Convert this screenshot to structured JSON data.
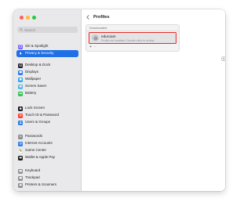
{
  "window": {
    "title": "Profiles"
  },
  "search": {
    "placeholder": "Search"
  },
  "sidebar": {
    "items": [
      {
        "label": "Siri & Spotlight",
        "icon": "siri-icon",
        "color": "#7b61ff",
        "active": false
      },
      {
        "label": "Privacy & Security",
        "icon": "hand-icon",
        "color": "#1f6fe6",
        "active": true
      },
      {
        "label": "Desktop & Dock",
        "icon": "dock-icon",
        "color": "#1c1c1e",
        "active": false
      },
      {
        "label": "Displays",
        "icon": "display-icon",
        "color": "#2b7de9",
        "active": false
      },
      {
        "label": "Wallpaper",
        "icon": "wallpaper-icon",
        "color": "#32a6f0",
        "active": false
      },
      {
        "label": "Screen Saver",
        "icon": "screensaver-icon",
        "color": "#53b8e8",
        "active": false
      },
      {
        "label": "Battery",
        "icon": "battery-icon",
        "color": "#34c759",
        "active": false
      },
      {
        "label": "Lock Screen",
        "icon": "lock-icon",
        "color": "#1c1c1e",
        "active": false
      },
      {
        "label": "Touch ID & Password",
        "icon": "fingerprint-icon",
        "color": "#ff3b30",
        "active": false
      },
      {
        "label": "Users & Groups",
        "icon": "users-icon",
        "color": "#2b7de9",
        "active": false
      },
      {
        "label": "Passwords",
        "icon": "key-icon",
        "color": "#8e8e93",
        "active": false
      },
      {
        "label": "Internet Accounts",
        "icon": "at-icon",
        "color": "#2b7de9",
        "active": false
      },
      {
        "label": "Game Center",
        "icon": "game-center-icon",
        "color": "#ffffff",
        "active": false
      },
      {
        "label": "Wallet & Apple Pay",
        "icon": "wallet-icon",
        "color": "#1c1c1e",
        "active": false
      },
      {
        "label": "Keyboard",
        "icon": "keyboard-icon",
        "color": "#8e8e93",
        "active": false
      },
      {
        "label": "Trackpad",
        "icon": "trackpad-icon",
        "color": "#8e8e93",
        "active": false
      },
      {
        "label": "Printers & Scanners",
        "icon": "printer-icon",
        "color": "#8e8e93",
        "active": false
      }
    ]
  },
  "profiles": {
    "section_header": "Downloaded",
    "items": [
      {
        "name": "eduroam",
        "status": "Profile not installed. Double-click to review."
      }
    ],
    "add_label": "+",
    "remove_label": "–"
  },
  "help": {
    "label": "?"
  }
}
